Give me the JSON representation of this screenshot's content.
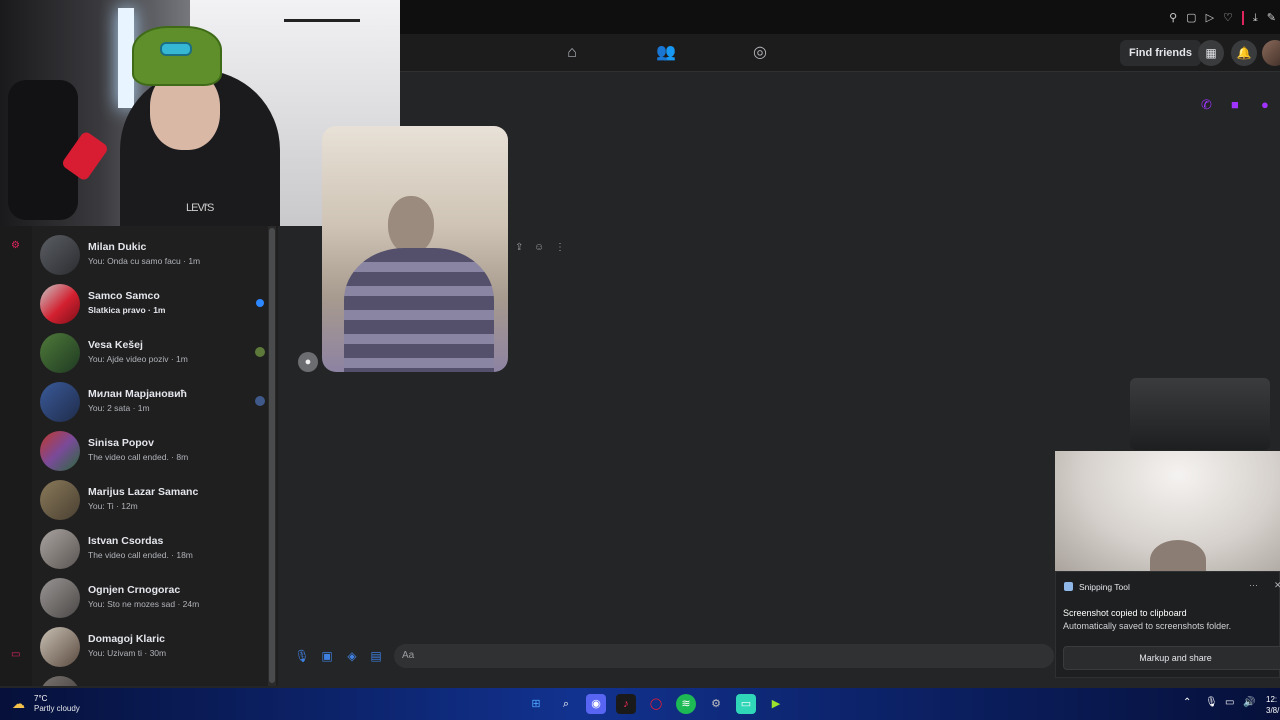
{
  "header": {
    "find_friends": "Find friends",
    "nav_icons": [
      "home-icon",
      "friends-icon",
      "groups-icon"
    ],
    "right_icons": [
      "menu-grid-icon",
      "bell-icon"
    ]
  },
  "call_icons": [
    "phone-icon",
    "video-call-icon",
    "info-icon"
  ],
  "chats": [
    {
      "name": "Milan Dukic",
      "preview": "You: Onda cu samo facu · 1m",
      "unread": false
    },
    {
      "name": "Samco Samco",
      "preview": "Slatkica pravo · 1m",
      "unread": true
    },
    {
      "name": "Vesa Kešej",
      "preview": "You: Ajde video poziv · 1m",
      "unread": false
    },
    {
      "name": "Милан Марјановић",
      "preview": "You: 2 sata · 1m",
      "unread": false
    },
    {
      "name": "Sinisa Popov",
      "preview": "The video call ended. · 8m",
      "unread": false
    },
    {
      "name": "Marijus Lazar Samanc",
      "preview": "You: Ti · 12m",
      "unread": false
    },
    {
      "name": "Istvan Csordas",
      "preview": "The video call ended. · 18m",
      "unread": false
    },
    {
      "name": "Ognjen Crnogorac",
      "preview": "You: Sto ne mozes sad · 24m",
      "unread": false
    },
    {
      "name": "Domagoj Klaric",
      "preview": "You: Uzivam ti · 30m",
      "unread": false
    }
  ],
  "webcam": {
    "shirt_logo": "LEVI'S"
  },
  "composer": {
    "placeholder": "Aa"
  },
  "notification": {
    "app": "Snipping Tool",
    "title": "Screenshot copied to clipboard",
    "body": "Automatically saved to screenshots folder.",
    "button": "Markup and share"
  },
  "taskbar": {
    "temperature": "7°C",
    "weather": "Partly cloudy",
    "time": "12:",
    "date": "3/8/"
  },
  "colors": {
    "accent_purple": "#a033ff",
    "unread_blue": "#2d88ff",
    "rail_red": "#e0245e"
  }
}
